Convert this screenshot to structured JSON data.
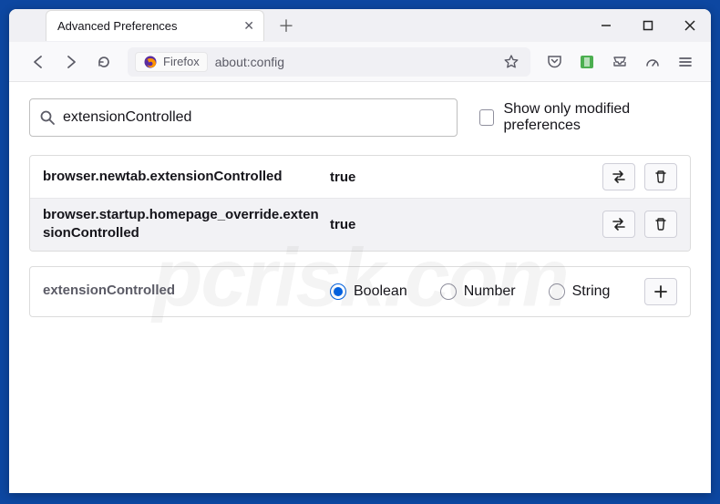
{
  "tab": {
    "title": "Advanced Preferences"
  },
  "urlbar": {
    "identity": "Firefox",
    "value": "about:config"
  },
  "search": {
    "value": "extensionControlled",
    "checkbox_label": "Show only modified preferences"
  },
  "prefs": [
    {
      "name": "browser.newtab.extensionControlled",
      "value": "true"
    },
    {
      "name": "browser.startup.homepage_override.extensionControlled",
      "value": "true"
    }
  ],
  "newpref": {
    "name": "extensionControlled",
    "types": {
      "boolean": "Boolean",
      "number": "Number",
      "string": "String"
    }
  },
  "watermark": "pcrisk.com"
}
